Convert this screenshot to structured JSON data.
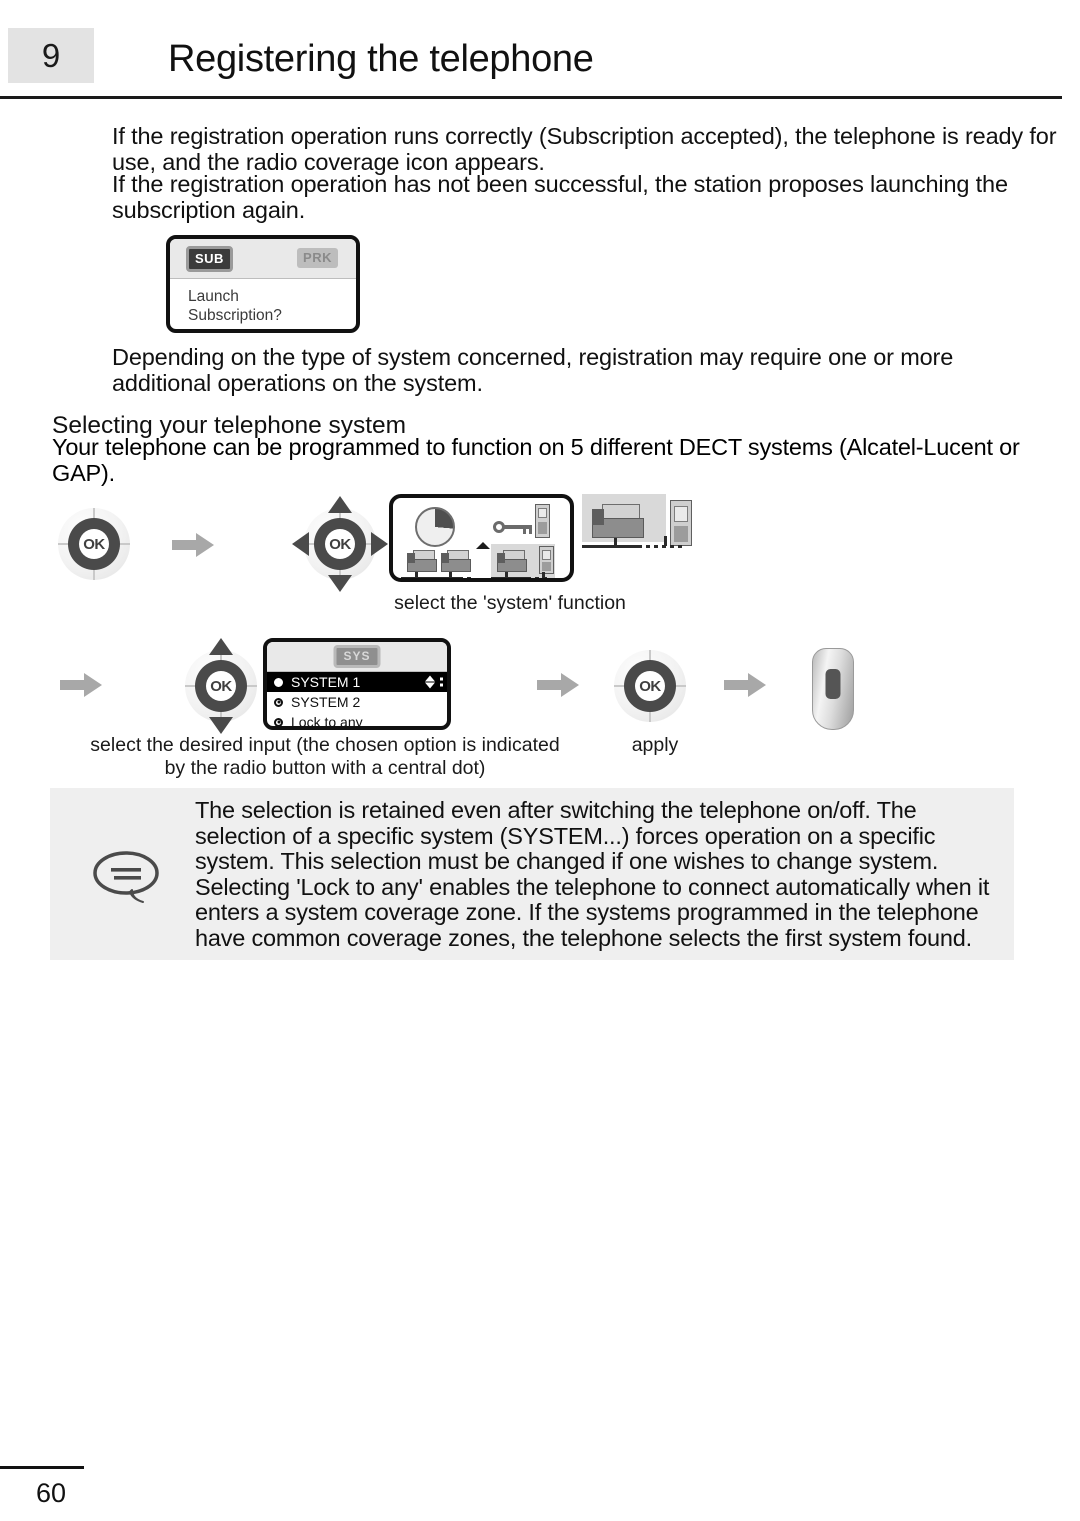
{
  "document": {
    "chapter_number": "9",
    "title": "Registering the telephone",
    "page_number": "60"
  },
  "paragraphs": {
    "p1": "If the registration operation runs correctly (Subscription accepted), the telephone is ready for use, and the radio coverage icon appears.",
    "p2": "If the registration operation has not been successful, the station proposes launching the subscription again.",
    "p3": "Depending on the type of system concerned, registration may require one or more additional operations on the system."
  },
  "section": {
    "heading": "Selecting your telephone system",
    "intro": "Your telephone can be programmed to function on 5 different DECT systems (Alcatel-Lucent or GAP)."
  },
  "lcd_subscription": {
    "picto_left": "SUB",
    "picto_right": "PRK",
    "line1": "Launch",
    "line2": "Subscription?"
  },
  "lcd_system": {
    "picto": "SYS",
    "items": [
      {
        "label": "SYSTEM 1",
        "selected": true
      },
      {
        "label": "SYSTEM 2",
        "selected": false
      },
      {
        "label": "Lock to any",
        "selected": false
      }
    ],
    "scroll_indicator": "up-down-arrows"
  },
  "navigator": {
    "ok_label": "OK"
  },
  "captions": {
    "step1": "select the 'system' function",
    "step2": "select the desired input (the chosen option is indicated by the radio button with a central dot)",
    "step3": "apply"
  },
  "note": {
    "icon": "note-bubble-icon",
    "text": "The selection is retained even after switching the telephone on/off. The selection of a specific system (SYSTEM...) forces operation on a specific system. This selection must be changed if one wishes to change system. Selecting 'Lock to any' enables the telephone to connect automatically when it enters a system coverage zone. If the systems programmed in the telephone have common coverage zones, the telephone selects the first system found."
  },
  "colors": {
    "badge_bg": "#e3e3e3",
    "note_bg": "#efefef",
    "lcd_status_bg": "#e9e9e9",
    "navigator_ring": "#4a4a4a",
    "arrow_grey": "#a8a8a8",
    "selected_row_bg": "#000000"
  }
}
